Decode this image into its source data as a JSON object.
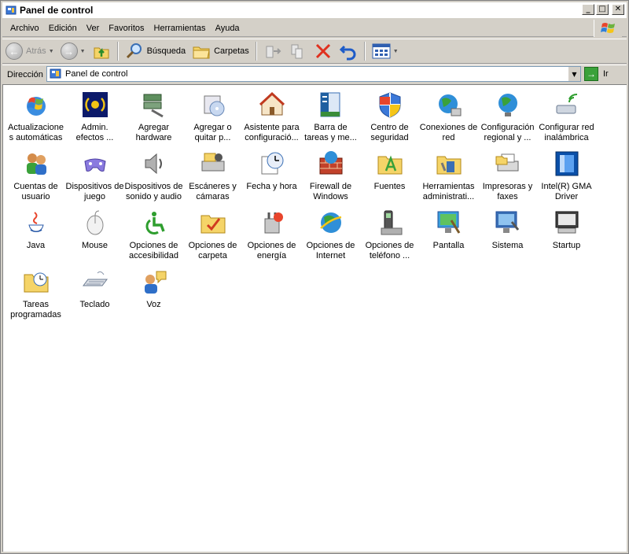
{
  "window": {
    "title": "Panel de control",
    "buttons": {
      "minimize": "_",
      "maximize": "□",
      "close": "✕"
    }
  },
  "menu": [
    "Archivo",
    "Edición",
    "Ver",
    "Favoritos",
    "Herramientas",
    "Ayuda"
  ],
  "toolbar": {
    "back_label": "Atrás",
    "search_label": "Búsqueda",
    "folders_label": "Carpetas"
  },
  "address": {
    "label": "Dirección",
    "value": "Panel de control",
    "go_label": "Ir"
  },
  "items": [
    {
      "label": "Actualizacione\ns automáticas",
      "icon": "windows-update-icon"
    },
    {
      "label": "Admin.\nefectos ...",
      "icon": "audio-effects-icon"
    },
    {
      "label": "Agregar\nhardware",
      "icon": "add-hardware-icon"
    },
    {
      "label": "Agregar o\nquitar p...",
      "icon": "add-remove-programs-icon"
    },
    {
      "label": "Asistente para\nconfiguració...",
      "icon": "network-setup-wizard-icon"
    },
    {
      "label": "Barra de\ntareas y me...",
      "icon": "taskbar-icon"
    },
    {
      "label": "Centro de\nseguridad",
      "icon": "security-center-icon"
    },
    {
      "label": "Conexiones de\nred",
      "icon": "network-connections-icon"
    },
    {
      "label": "Configuración\nregional y ...",
      "icon": "regional-settings-icon"
    },
    {
      "label": "Configurar red\ninalámbrica",
      "icon": "wireless-network-icon"
    },
    {
      "label": "Cuentas de\nusuario",
      "icon": "user-accounts-icon"
    },
    {
      "label": "Dispositivos de\njuego",
      "icon": "game-controllers-icon"
    },
    {
      "label": "Dispositivos de\nsonido y audio",
      "icon": "sounds-audio-icon"
    },
    {
      "label": "Escáneres y\ncámaras",
      "icon": "scanners-cameras-icon"
    },
    {
      "label": "Fecha y hora",
      "icon": "date-time-icon"
    },
    {
      "label": "Firewall de\nWindows",
      "icon": "windows-firewall-icon"
    },
    {
      "label": "Fuentes",
      "icon": "fonts-folder-icon"
    },
    {
      "label": "Herramientas\nadministrati...",
      "icon": "admin-tools-icon"
    },
    {
      "label": "Impresoras y\nfaxes",
      "icon": "printers-faxes-icon"
    },
    {
      "label": "Intel(R) GMA\nDriver",
      "icon": "intel-gma-icon"
    },
    {
      "label": "Java",
      "icon": "java-icon"
    },
    {
      "label": "Mouse",
      "icon": "mouse-icon"
    },
    {
      "label": "Opciones de\naccesibilidad",
      "icon": "accessibility-icon"
    },
    {
      "label": "Opciones de\ncarpeta",
      "icon": "folder-options-icon"
    },
    {
      "label": "Opciones de\nenergía",
      "icon": "power-options-icon"
    },
    {
      "label": "Opciones de\nInternet",
      "icon": "internet-options-icon"
    },
    {
      "label": "Opciones de\nteléfono ...",
      "icon": "phone-modem-icon"
    },
    {
      "label": "Pantalla",
      "icon": "display-icon"
    },
    {
      "label": "Sistema",
      "icon": "system-icon"
    },
    {
      "label": "Startup",
      "icon": "startup-icon"
    },
    {
      "label": "Tareas\nprogramadas",
      "icon": "scheduled-tasks-icon"
    },
    {
      "label": "Teclado",
      "icon": "keyboard-icon"
    },
    {
      "label": "Voz",
      "icon": "speech-icon"
    }
  ]
}
